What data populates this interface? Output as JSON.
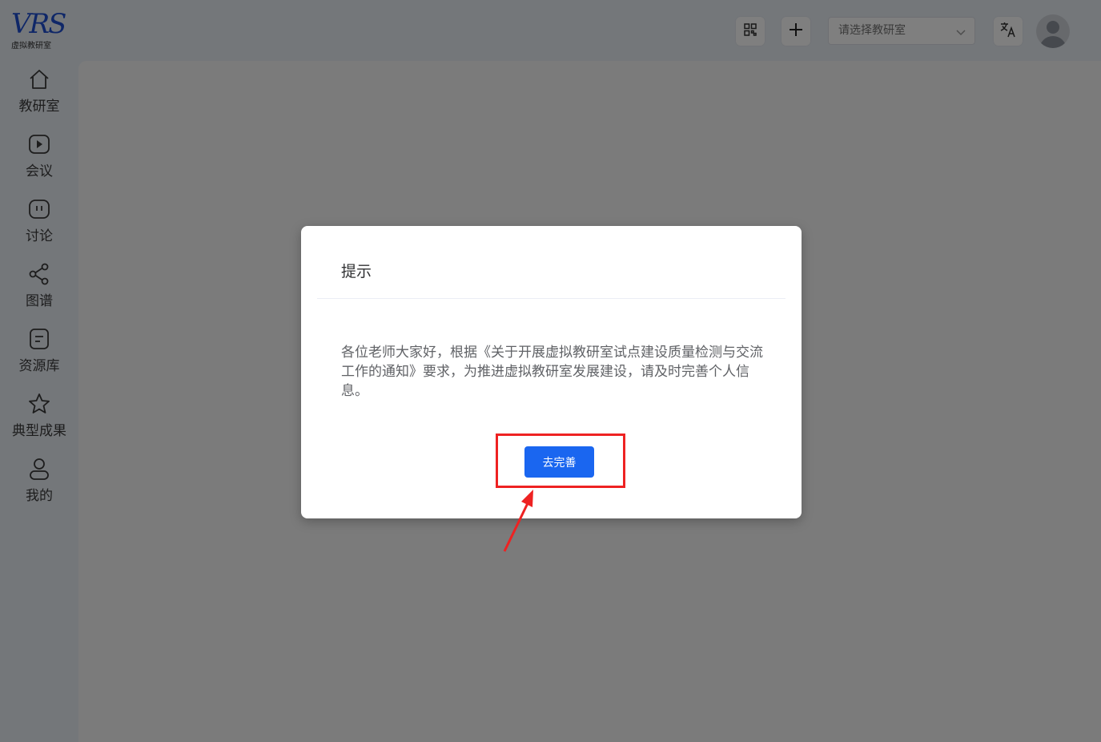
{
  "app": {
    "logo_text": "VRS",
    "logo_subtitle": "虚拟教研室"
  },
  "sidebar": {
    "items": [
      {
        "label": "教研室",
        "icon": "home-icon"
      },
      {
        "label": "会议",
        "icon": "video-play-icon"
      },
      {
        "label": "讨论",
        "icon": "chat-bubble-icon"
      },
      {
        "label": "图谱",
        "icon": "share-graph-icon"
      },
      {
        "label": "资源库",
        "icon": "document-icon"
      },
      {
        "label": "典型成果",
        "icon": "star-icon"
      },
      {
        "label": "我的",
        "icon": "user-icon"
      }
    ]
  },
  "header": {
    "qr_icon": "qr-code-icon",
    "add_icon": "plus-icon",
    "lab_select_placeholder": "请选择教研室",
    "translate_icon": "translate-icon",
    "avatar_icon": "user-avatar-icon"
  },
  "dialog": {
    "title": "提示",
    "message": "各位老师大家好，根据《关于开展虚拟教研室试点建设质量检测与交流工作的通知》要求，为推进虚拟教研室发展建设，请及时完善个人信息。",
    "confirm_label": "去完善"
  },
  "colors": {
    "primary": "#1a66f0",
    "logo": "#1f4fd1",
    "annotation": "#ee2222"
  }
}
